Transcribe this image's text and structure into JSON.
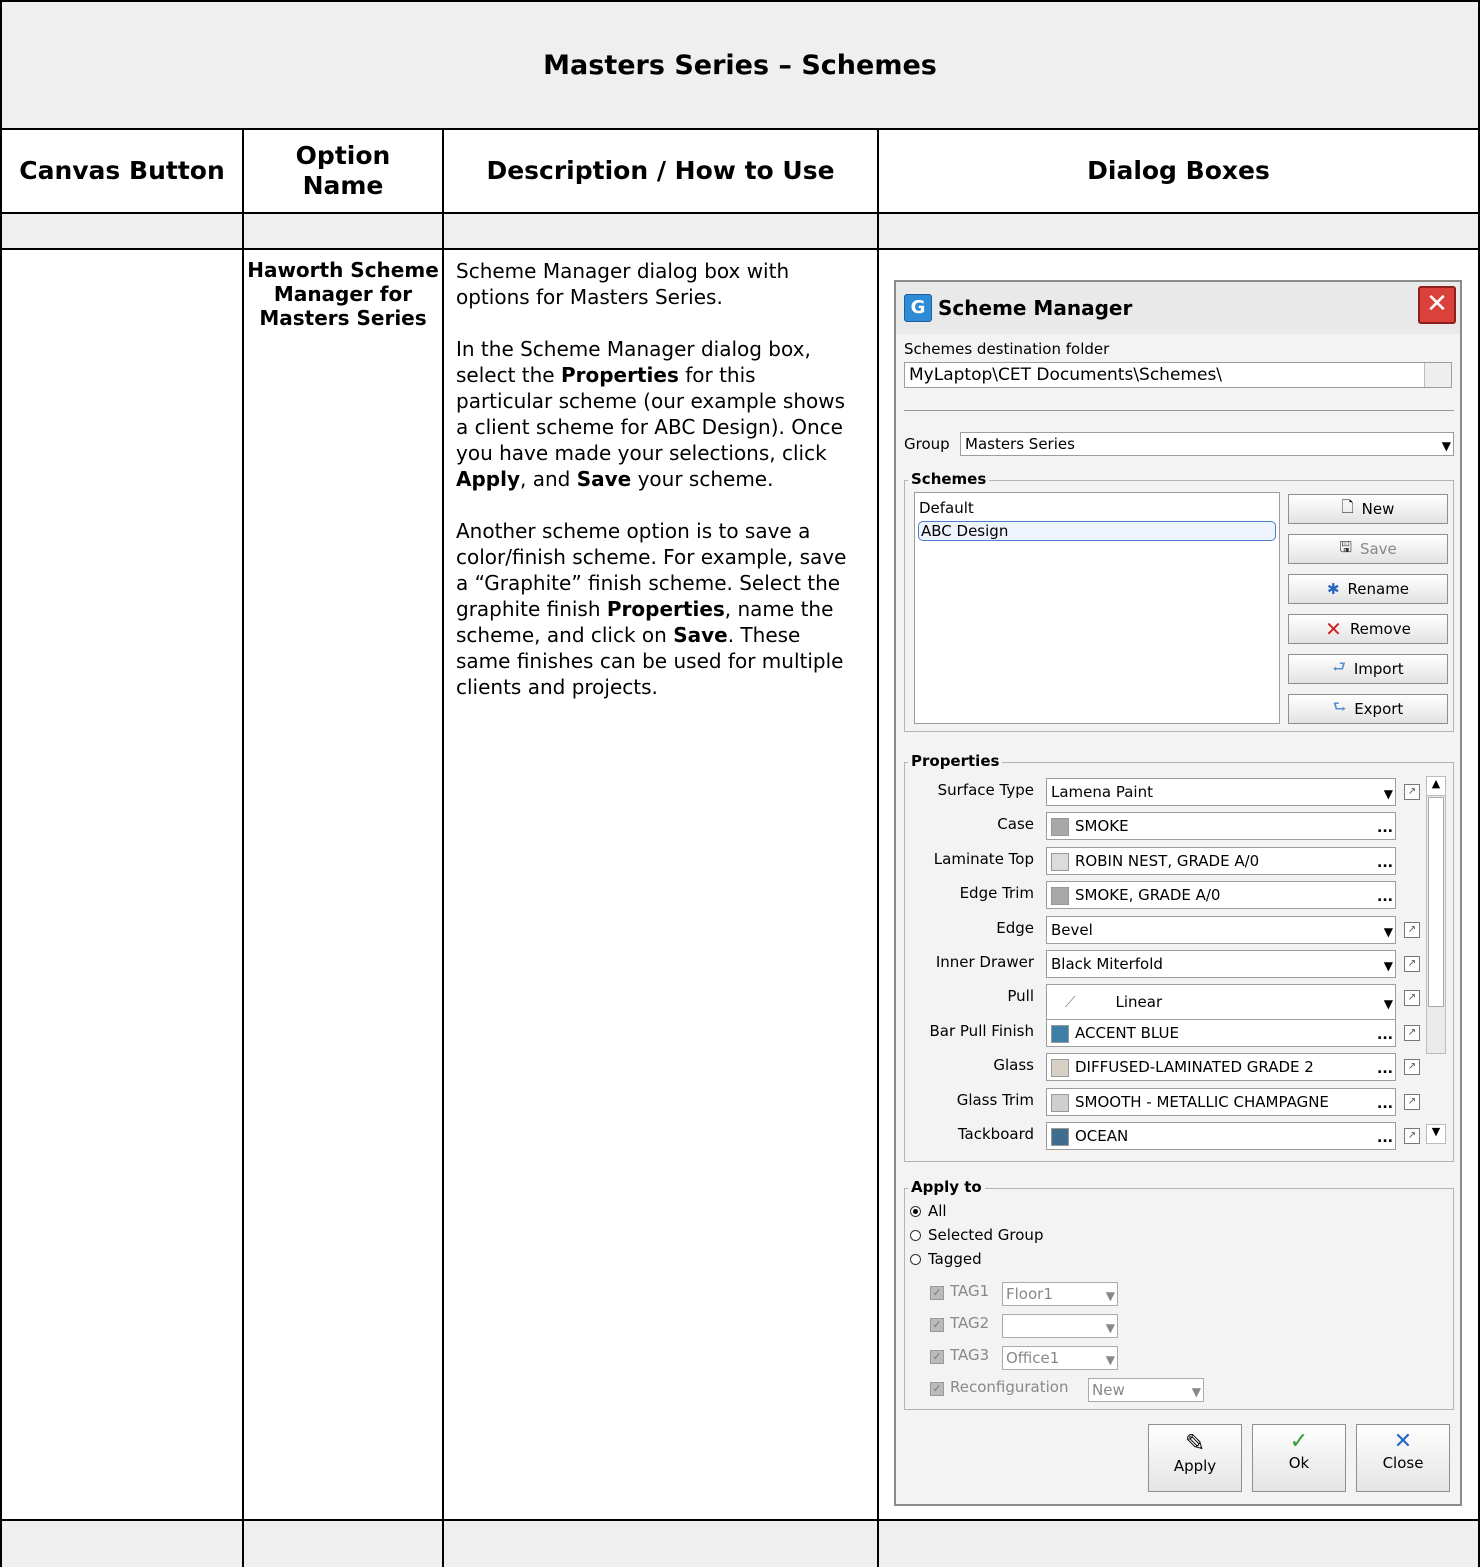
{
  "table": {
    "title": "Masters Series – Schemes",
    "headers": [
      "Canvas Button",
      "Option Name",
      "Description / How to Use",
      "Dialog Boxes"
    ],
    "row": {
      "option_name": "Haworth Scheme Manager for Masters Series",
      "description": {
        "p1": "Scheme Manager dialog box with options for Masters Series.",
        "p2a": "In the Scheme Manager dialog box, select the ",
        "p2b": "Properties",
        "p2c": " for this particular scheme (our example shows a client scheme for ABC Design). Once you have made your selections, click ",
        "p2d": "Apply",
        "p2e": ", and ",
        "p2f": "Save",
        "p2g": " your scheme.",
        "p3a": "Another scheme option is to save a color/finish scheme. For example, save a “Graphite” finish scheme. Select the graphite finish ",
        "p3b": "Properties",
        "p3c": ", name the scheme, and click on ",
        "p3d": "Save",
        "p3e": ". These same finishes can be used for multiple clients and projects."
      }
    }
  },
  "dialog": {
    "title": "Scheme Manager",
    "dest_label": "Schemes destination folder",
    "dest_value": "MyLaptop\\CET Documents\\Schemes\\",
    "group_label": "Group",
    "group_value": "Masters Series",
    "schemes_legend": "Schemes",
    "schemes": [
      "Default",
      "ABC Design"
    ],
    "buttons": {
      "new": "New",
      "save": "Save",
      "rename": "Rename",
      "remove": "Remove",
      "import": "Import",
      "export": "Export"
    },
    "properties_legend": "Properties",
    "properties": [
      {
        "label": "Surface Type",
        "value": "Lamena Paint",
        "kind": "dropdown",
        "color": ""
      },
      {
        "label": "Case",
        "value": "SMOKE",
        "kind": "browse",
        "color": "#a8a8a8"
      },
      {
        "label": "Laminate Top",
        "value": "ROBIN NEST, GRADE A/0",
        "kind": "browse",
        "color": "#dcdcdc"
      },
      {
        "label": "Edge Trim",
        "value": "SMOKE, GRADE A/0",
        "kind": "browse",
        "color": "#a8a8a8"
      },
      {
        "label": "Edge",
        "value": "Bevel",
        "kind": "dropdown",
        "color": ""
      },
      {
        "label": "Inner Drawer",
        "value": "Black Miterfold",
        "kind": "dropdown",
        "color": ""
      },
      {
        "label": "Pull",
        "value": "Linear",
        "kind": "dropdown",
        "color": ""
      },
      {
        "label": "Bar Pull Finish",
        "value": "ACCENT BLUE",
        "kind": "browse",
        "color": "#3f7fa6"
      },
      {
        "label": "Glass",
        "value": "DIFFUSED-LAMINATED GRADE 2",
        "kind": "browse",
        "color": "#d8d0c4"
      },
      {
        "label": "Glass Trim",
        "value": "SMOOTH - METALLIC CHAMPAGNE",
        "kind": "browse",
        "color": "#cfcfcf"
      },
      {
        "label": "Tackboard",
        "value": "OCEAN",
        "kind": "browse",
        "color": "#3f6d8e"
      }
    ],
    "apply_legend": "Apply to",
    "apply_options": [
      "All",
      "Selected Group",
      "Tagged"
    ],
    "apply_selected": "All",
    "tags": [
      {
        "label": "TAG1",
        "value": "Floor1"
      },
      {
        "label": "TAG2",
        "value": ""
      },
      {
        "label": "TAG3",
        "value": "Office1"
      },
      {
        "label": "Reconfiguration",
        "value": "New"
      }
    ],
    "footer_buttons": {
      "apply": "Apply",
      "ok": "Ok",
      "close": "Close"
    }
  }
}
